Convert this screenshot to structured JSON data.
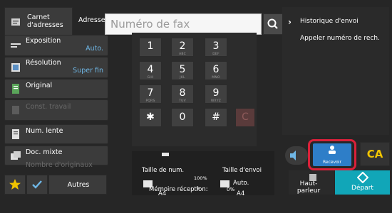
{
  "address_bar": {
    "carnet_label": "Carnet d'adresses",
    "adresse_label": "Adresse",
    "fax_placeholder": "Numéro de fax"
  },
  "left_menu": [
    {
      "label": "Exposition",
      "value": "Auto.",
      "icon": "exposure-icon",
      "enabled": true
    },
    {
      "label": "Résolution",
      "value": "Super fin",
      "icon": "resolution-icon",
      "enabled": true
    },
    {
      "label": "Original",
      "value": "",
      "icon": "original-icon",
      "enabled": true
    },
    {
      "label": "Const. travail",
      "value": "",
      "icon": "job-build-icon",
      "enabled": false
    },
    {
      "label": "Num. lente",
      "value": "",
      "icon": "slow-scan-icon",
      "enabled": true
    },
    {
      "label": "Doc. mixte",
      "value": "",
      "icon": "mixed-doc-icon",
      "enabled": true
    },
    {
      "label": "Nombre d'originaux",
      "value": "",
      "icon": "original-count-icon",
      "enabled": false
    }
  ],
  "bottom_left": {
    "autres_label": "Autres"
  },
  "keypad": {
    "keys": [
      {
        "num": "1",
        "sub": ""
      },
      {
        "num": "2",
        "sub": "ABC"
      },
      {
        "num": "3",
        "sub": "DEF"
      },
      {
        "num": "4",
        "sub": "GHI"
      },
      {
        "num": "5",
        "sub": "JKL"
      },
      {
        "num": "6",
        "sub": "MNO"
      },
      {
        "num": "7",
        "sub": "PQRS"
      },
      {
        "num": "8",
        "sub": "TUV"
      },
      {
        "num": "9",
        "sub": "WXYZ"
      },
      {
        "num": "✱",
        "sub": ""
      },
      {
        "num": "0",
        "sub": ""
      },
      {
        "num": "#",
        "sub": ""
      },
      {
        "num": "C",
        "sub": ""
      }
    ]
  },
  "status": {
    "scan_size_label": "Taille de num.",
    "send_size_label": "Taille d'envoi",
    "ratio": "100%",
    "send_size_value": "Auto.",
    "scan_paper": "A4",
    "send_paper": "A4",
    "memory_label": "Mémoire réception:",
    "memory_value": "0%"
  },
  "right_panel": {
    "history_label": "Historique d'envoi",
    "recall_label": "Appeler numéro de rech."
  },
  "actions": {
    "recevoir_label": "Recevoir",
    "ca_label": "CA",
    "haut_parleur_label": "Haut-parleur",
    "depart_label": "Départ"
  },
  "colors": {
    "accent_blue": "#2e7ec8",
    "highlight_red": "#d9213a",
    "start_teal": "#11a6b8",
    "ca_yellow": "#f0c400",
    "value_blue": "#6fb7e6"
  }
}
